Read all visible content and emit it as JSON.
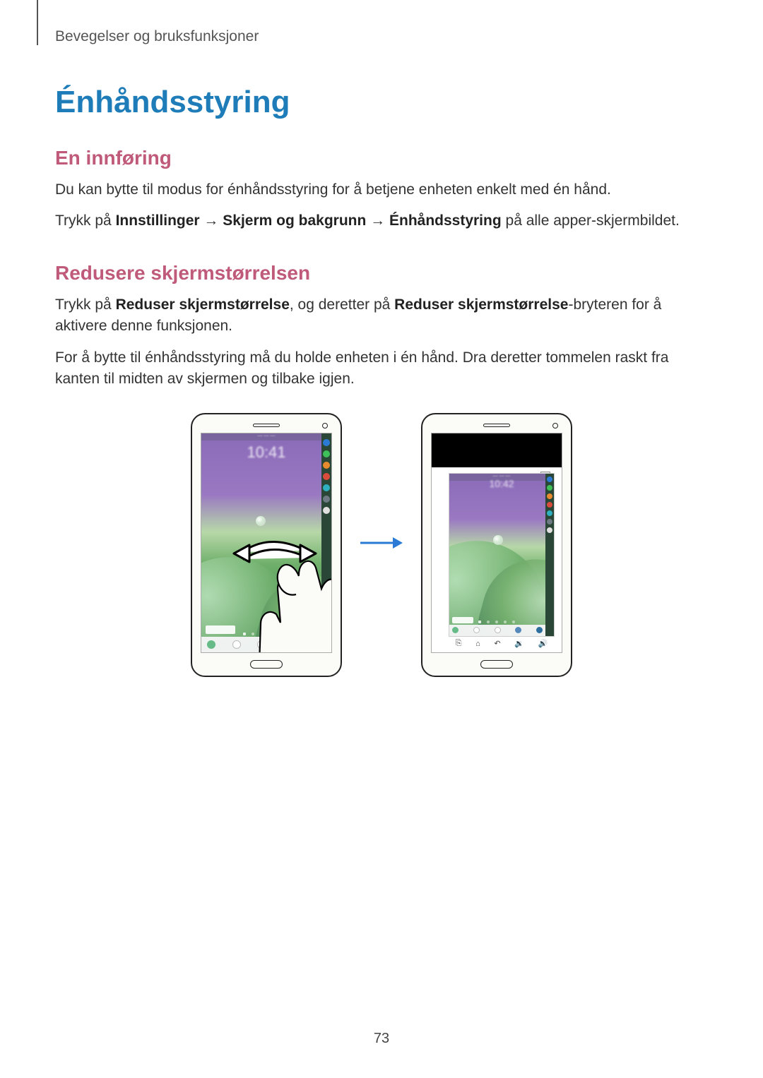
{
  "breadcrumb": "Bevegelser og bruksfunksjoner",
  "title": "Énhåndsstyring",
  "section1": {
    "heading": "En innføring",
    "p1": "Du kan bytte til modus for énhåndsstyring for å betjene enheten enkelt med én hånd.",
    "p2_pre": "Trykk på ",
    "p2_b1": "Innstillinger",
    "p2_mid1": " → ",
    "p2_b2": "Skjerm og bakgrunn",
    "p2_mid2": " → ",
    "p2_b3": "Énhåndsstyring",
    "p2_post": " på alle apper-skjermbildet."
  },
  "section2": {
    "heading": "Redusere skjermstørrelsen",
    "p1_pre": "Trykk på ",
    "p1_b1": "Reduser skjermstørrelse",
    "p1_mid": ", og deretter på ",
    "p1_b2": "Reduser skjermstørrelse",
    "p1_post": "-bryteren for å aktivere denne funksjonen.",
    "p2": "For å bytte til énhåndsstyring må du holde enheten i én hånd. Dra deretter tommelen raskt fra kanten til midten av skjermen og tilbake igjen."
  },
  "figure": {
    "clock_left": "10:41",
    "clock_right": "10:42",
    "close_glyph": "⊠",
    "nav": {
      "recent": "⎘",
      "home": "⌂",
      "back": "↶",
      "voldown": "🔉",
      "volup": "🔊"
    }
  },
  "page_number": "73"
}
